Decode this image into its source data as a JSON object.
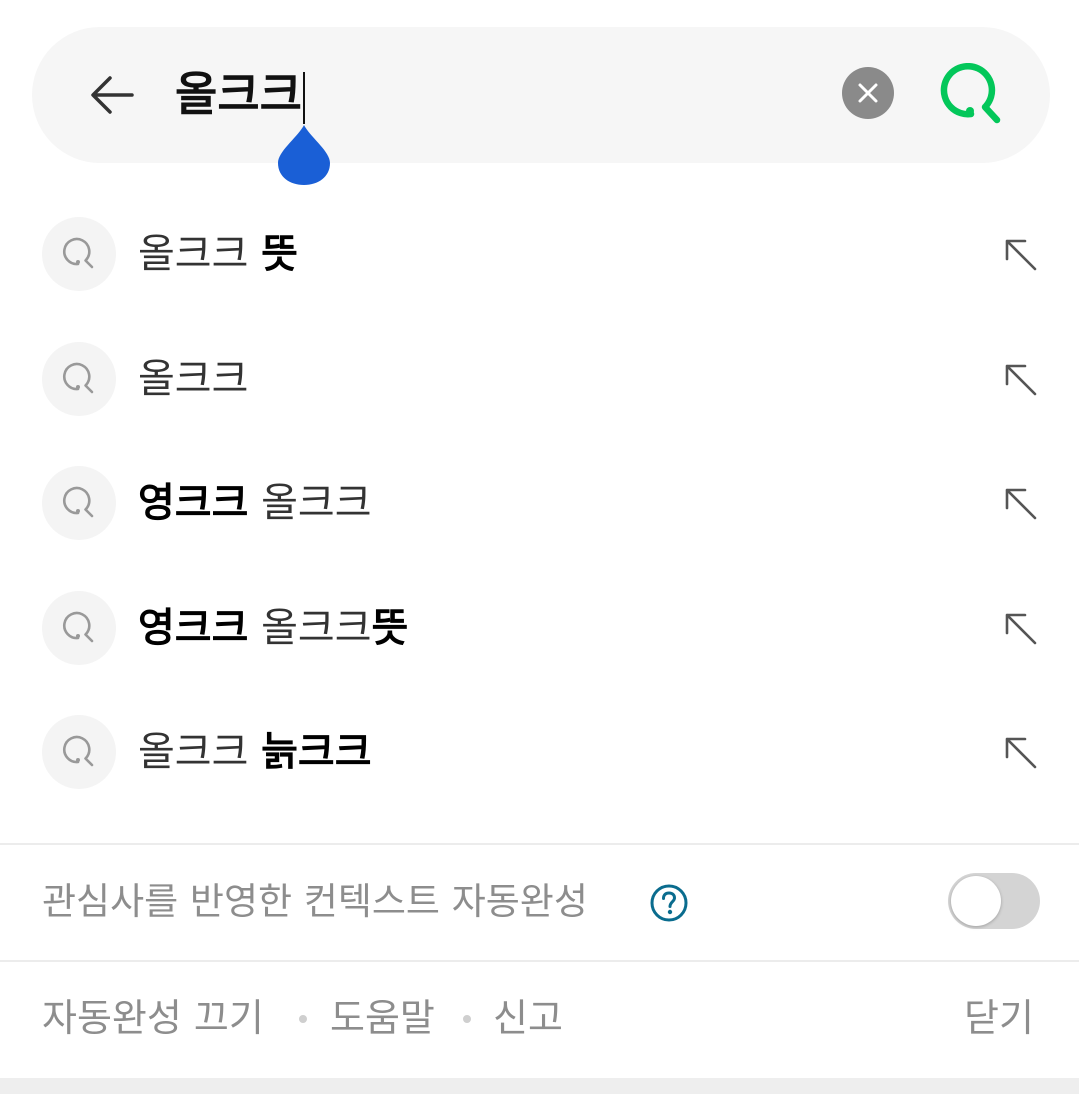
{
  "search": {
    "query": "올크크",
    "colors": {
      "search_green": "#03c75a",
      "handle_blue": "#1a5fd6"
    },
    "icons": {
      "back": "back-arrow-icon",
      "clear": "clear-x-icon",
      "submit": "search-icon"
    }
  },
  "suggestions": [
    {
      "parts": [
        {
          "text": "올크크 ",
          "bold": false
        },
        {
          "text": "뜻",
          "bold": true
        }
      ]
    },
    {
      "parts": [
        {
          "text": "올크크",
          "bold": false
        }
      ]
    },
    {
      "parts": [
        {
          "text": "영크크",
          "bold": true
        },
        {
          "text": " 올크크",
          "bold": false
        }
      ]
    },
    {
      "parts": [
        {
          "text": "영크크",
          "bold": true
        },
        {
          "text": " 올크크",
          "bold": false
        },
        {
          "text": "뜻",
          "bold": true
        }
      ]
    },
    {
      "parts": [
        {
          "text": "올크크 ",
          "bold": false
        },
        {
          "text": "늙크크",
          "bold": true
        }
      ]
    }
  ],
  "context": {
    "label": "관심사를 반영한 컨텍스트 자동완성",
    "toggle_on": false
  },
  "footer": {
    "autocomplete_off": "자동완성 끄기",
    "help": "도움말",
    "report": "신고",
    "close": "닫기"
  }
}
